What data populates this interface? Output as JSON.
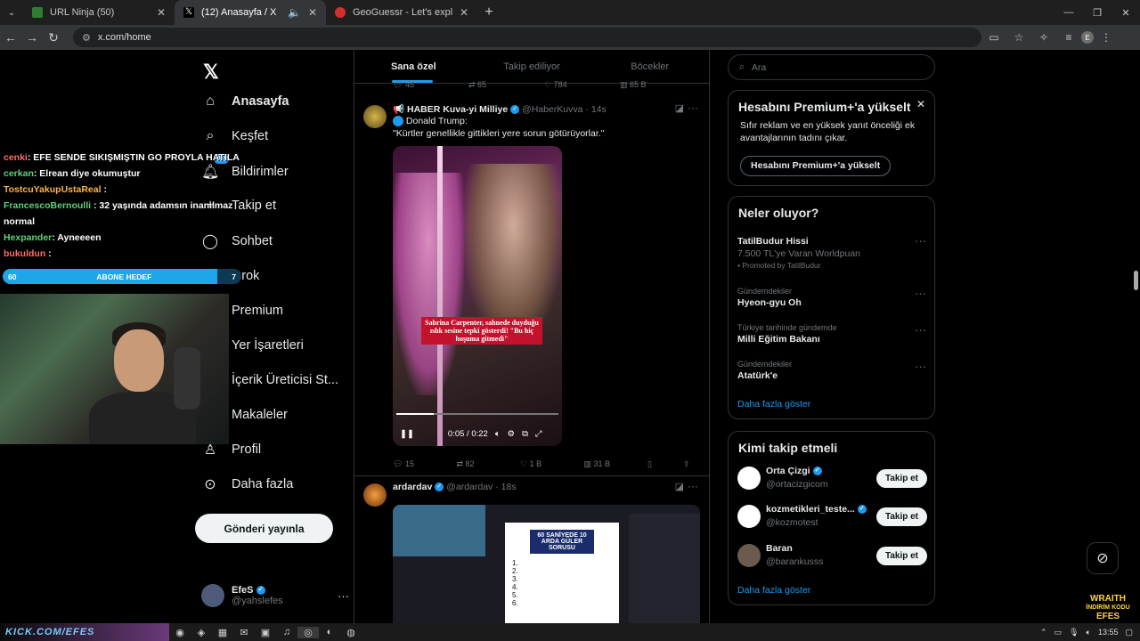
{
  "browser": {
    "tabs": [
      {
        "title": "URL Ninja (50)",
        "favicon": "green-square-icon"
      },
      {
        "title": "(12) Anasayfa / X",
        "favicon": "x-logo-icon"
      },
      {
        "title": "GeoGuessr - Let's explore the w",
        "favicon": "map-pin-icon"
      }
    ],
    "url": "x.com/home",
    "profile_initial": "E"
  },
  "sidebar": {
    "logo": "𝕏",
    "nav": [
      {
        "label": "Anasayfa",
        "icon": "home-icon"
      },
      {
        "label": "Keşfet",
        "icon": "search-icon"
      },
      {
        "label": "Bildirimler",
        "icon": "bell-icon",
        "badge": "12"
      },
      {
        "label": "Takip et",
        "icon": "follow-icon"
      },
      {
        "label": "Sohbet",
        "icon": "chat-icon"
      },
      {
        "label": "Grok",
        "icon": "grok-icon"
      },
      {
        "label": "Premium",
        "icon": "x-premium-icon"
      },
      {
        "label": "Yer İşaretleri",
        "icon": "bookmark-icon"
      },
      {
        "label": "İçerik Üreticisi St...",
        "icon": "creator-studio-icon"
      },
      {
        "label": "Makaleler",
        "icon": "articles-icon"
      },
      {
        "label": "Profil",
        "icon": "profile-icon"
      },
      {
        "label": "Daha fazla",
        "icon": "more-circle-icon"
      }
    ],
    "post_button": "Gönderi yayınla",
    "user": {
      "name": "EfeS",
      "handle": "@yahslefes"
    }
  },
  "main": {
    "tabs": [
      "Sana özel",
      "Takip ediliyor",
      "Böcekler"
    ],
    "prev_stats": {
      "replies": "45",
      "reposts": "65",
      "likes": "784",
      "views": "65 B"
    },
    "tweet1": {
      "name": "HABER Kuva-yi Milliye",
      "handle": "@HaberKuvva",
      "time": "14s",
      "line1": "Donald Trump:",
      "line2": "\"Kürtler genellikle gittikleri yere sorun götürüyorlar.\"",
      "video_caption": "Sabrina Carpenter, sahnede duyduğu ıslık sesine tepki gösterdi! \"Bu hiç hoşuma gitmedi\"",
      "video_time": "0:05 / 0:22",
      "progress": 0.23,
      "replies": "15",
      "reposts": "82",
      "likes": "1 B",
      "views": "31 B"
    },
    "tweet2": {
      "name": "ardardav",
      "handle": "@ardardav",
      "time": "18s",
      "card_title": "60 SANİYEDE 10 ARDA GÜLER SORUSU",
      "card_items": [
        "1.",
        "2.",
        "3.",
        "4.",
        "5.",
        "6."
      ]
    }
  },
  "right": {
    "search_placeholder": "Ara",
    "premium": {
      "title": "Hesabını Premium+'a yükselt",
      "text": "Sıfır reklam ve en yüksek yanıt önceliği ek avantajlarının tadını çıkar.",
      "button": "Hesabını Premium+'a yükselt"
    },
    "trends": {
      "title": "Neler oluyor?",
      "items": [
        {
          "context": "",
          "title": "TatilBudur Hissi",
          "subtitle": "7.500 TL'ye Varan Worldpuan",
          "promo": "Promoted by TatilBudur"
        },
        {
          "context": "Gündemdekiler",
          "title": "Hyeon-gyu Oh"
        },
        {
          "context": "Türkiye tarihinde gündemde",
          "title": "Milli Eğitim Bakanı"
        },
        {
          "context": "Gündemdekiler",
          "title": "Atatürk'e"
        }
      ],
      "more": "Daha fazla göster"
    },
    "who": {
      "title": "Kimi takip etmeli",
      "items": [
        {
          "name": "Orta Çizgi",
          "handle": "@ortacizgicom",
          "button": "Takip et"
        },
        {
          "name": "kozmetikleri_teste...",
          "handle": "@kozmotest",
          "button": "Takip et"
        },
        {
          "name": "Baran",
          "handle": "@barankusss",
          "button": "Takip et"
        }
      ],
      "more": "Daha fazla göster"
    }
  },
  "overlay": {
    "chat": [
      {
        "user": "cenki",
        "msg": ": EFE SENDE SIKIŞMIŞTIN GO PROYLA HATILA"
      },
      {
        "user": "cerkan",
        "msg": ": Elrean diye okumuştur"
      },
      {
        "user": "TostcuYakupUstaReal",
        "msg": ":"
      },
      {
        "user": "FrancescoBernoulli",
        "msg": ": 32 yaşında adamsın inanılmaz normal"
      },
      {
        "user": "Hexpander",
        "msg": ": Ayneeeen"
      },
      {
        "user": "bukuldun",
        "msg": ":"
      }
    ],
    "goal_left": "60",
    "goal_label": "ABONE HEDEF",
    "goal_right": "7",
    "goal_fraction": 0.9,
    "wraith_title": "WRAITH",
    "wraith_sub": "İNDİRİM KODU",
    "wraith_code": "EFES",
    "taskbar_brand": "KICK.COM/EFES",
    "clock": "13:55"
  },
  "colors": {
    "accent": "#1d9bf0",
    "bg": "#000000",
    "border": "#2f3336",
    "muted": "#71767b"
  }
}
